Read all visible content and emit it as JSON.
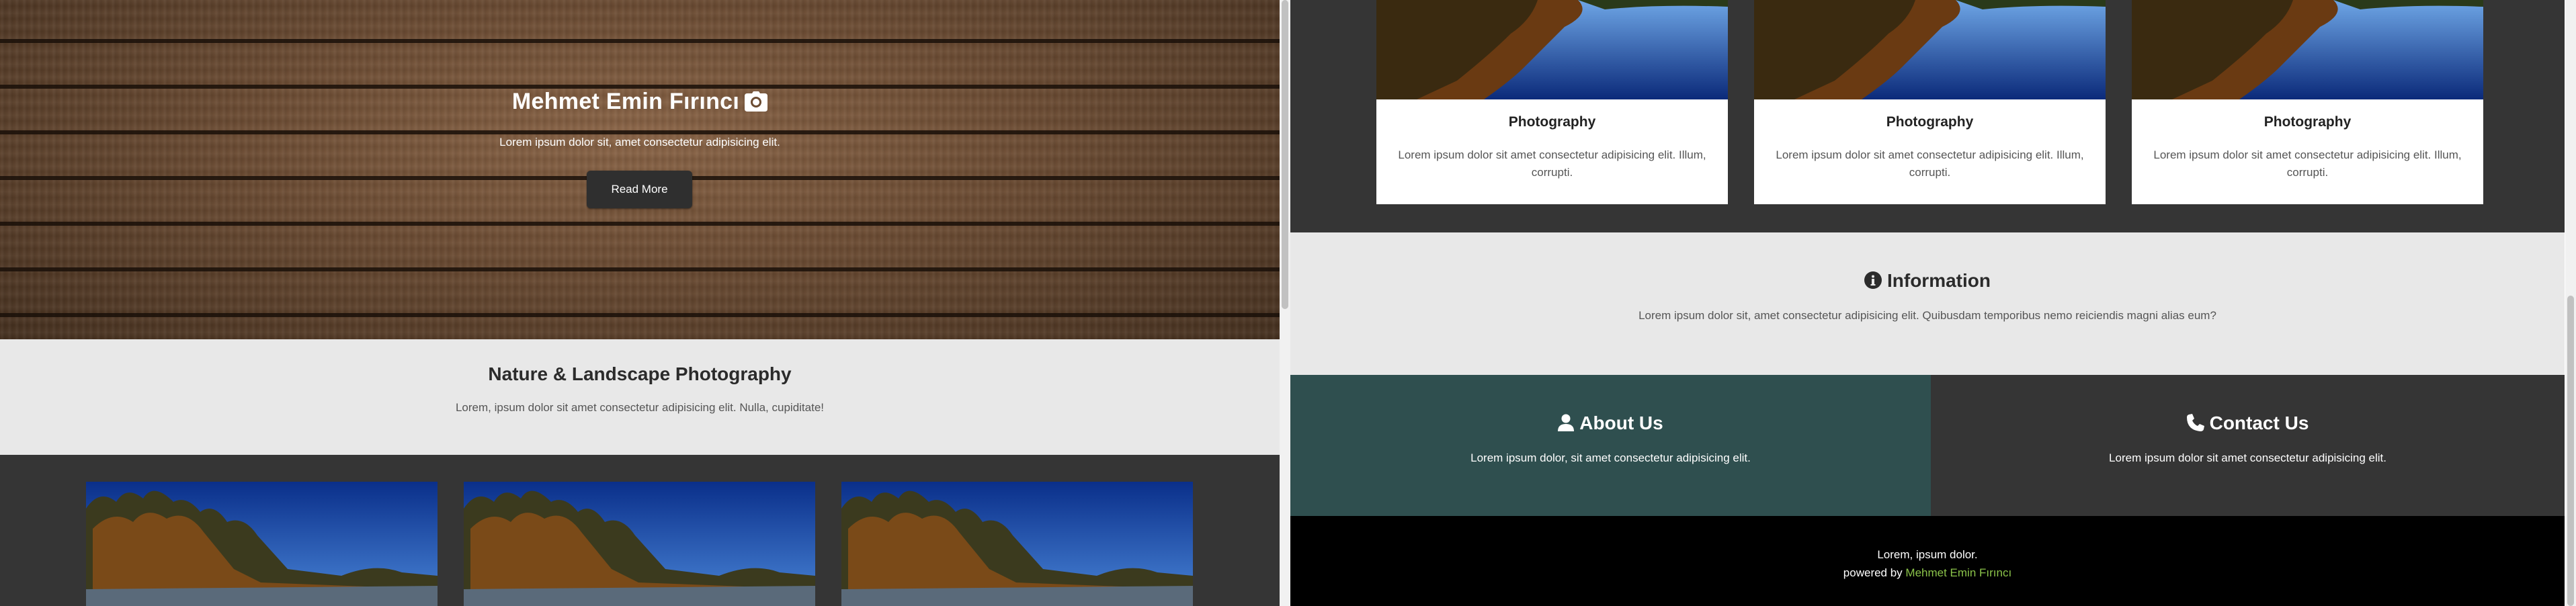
{
  "hero": {
    "title": "Mehmet Emin Fırıncı",
    "subtitle": "Lorem ipsum dolor sit, amet consectetur adipisicing elit.",
    "button_label": "Read More"
  },
  "nature": {
    "title": "Nature & Landscape Photography",
    "subtitle": "Lorem, ipsum dolor sit amet consectetur adipisicing elit. Nulla, cupiditate!"
  },
  "cards": [
    {
      "title": "Photography",
      "text": "Lorem ipsum dolor sit amet consectetur adipisicing elit. Illum, corrupti."
    },
    {
      "title": "Photography",
      "text": "Lorem ipsum dolor sit amet consectetur adipisicing elit. Illum, corrupti."
    },
    {
      "title": "Photography",
      "text": "Lorem ipsum dolor sit amet consectetur adipisicing elit. Illum, corrupti."
    }
  ],
  "information": {
    "title": "Information",
    "text": "Lorem ipsum dolor sit, amet consectetur adipisicing elit. Quibusdam temporibus nemo reiciendis magni alias eum?"
  },
  "about": {
    "title": "About Us",
    "text": "Lorem ipsum dolor, sit amet consectetur adipisicing elit."
  },
  "contact": {
    "title": "Contact Us",
    "text": "Lorem ipsum dolor sit amet consectetur adipisicing elit."
  },
  "footer": {
    "line1": "Lorem, ipsum dolor.",
    "powered_prefix": "powered by",
    "credit": "Mehmet Emin Fırıncı"
  },
  "colors": {
    "about_bg": "#2f4f4f",
    "dark_bg": "#353535",
    "light_bg": "#e8e8e8",
    "credit": "#8bc34a",
    "footer_bg": "#000000"
  },
  "icons": {
    "hero": "camera-icon",
    "information": "info-circle-icon",
    "about": "user-icon",
    "contact": "phone-icon"
  }
}
